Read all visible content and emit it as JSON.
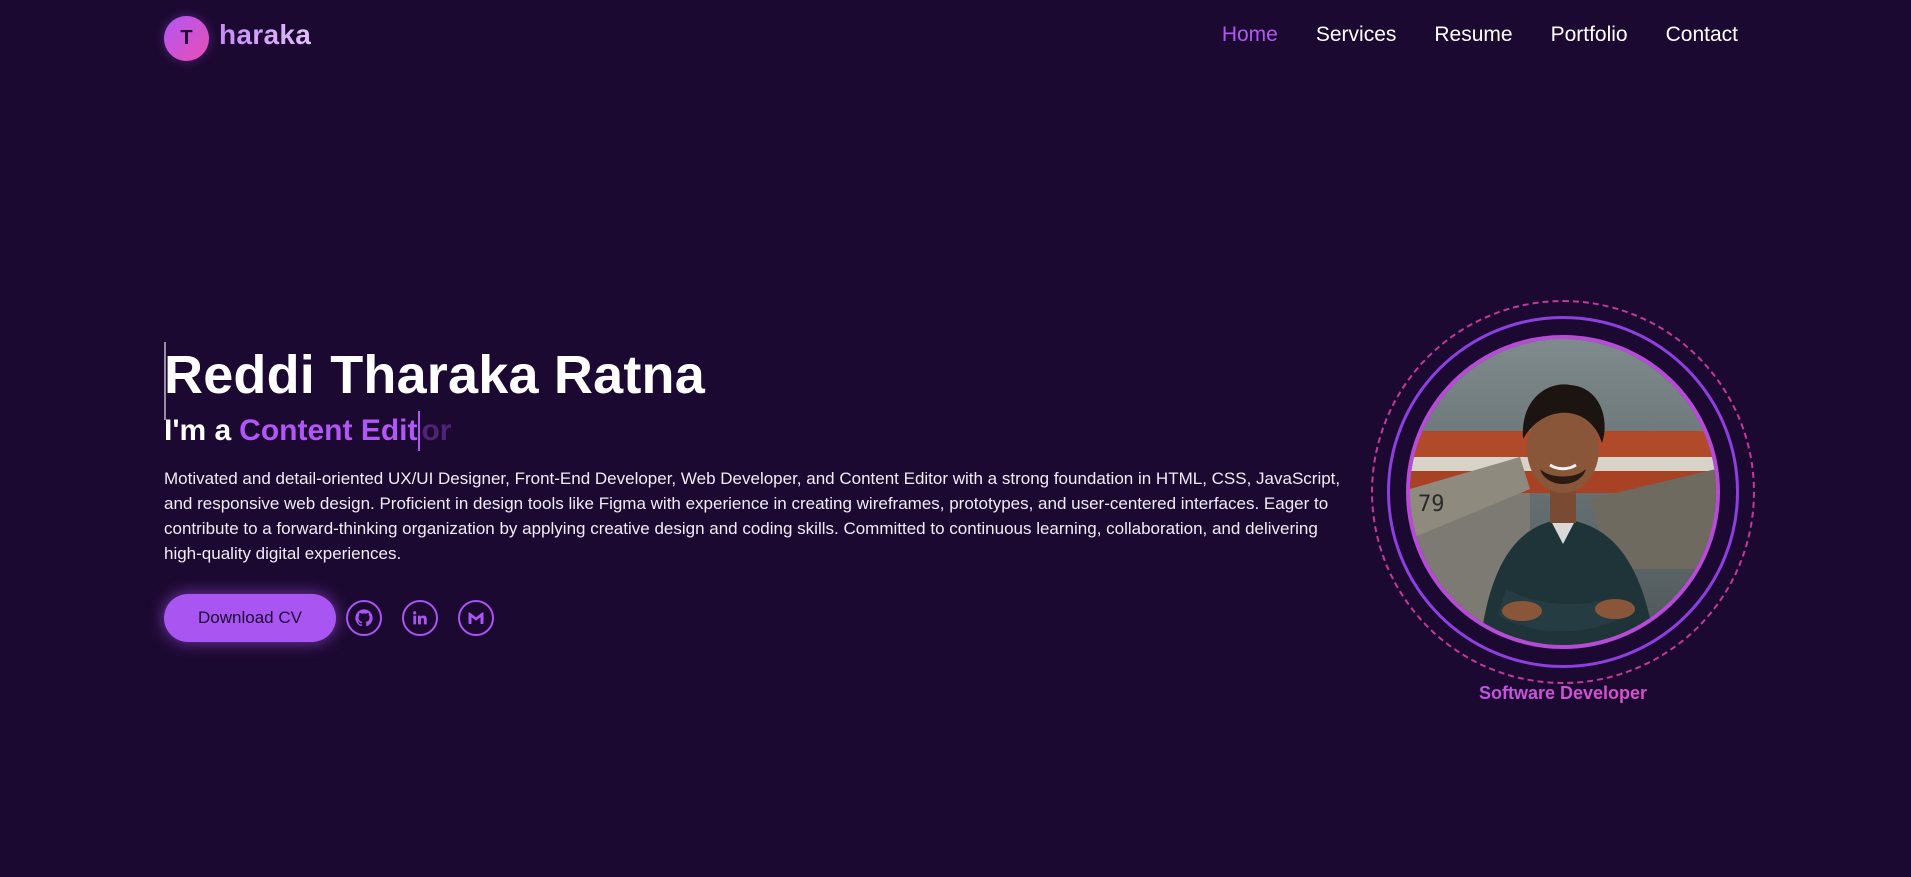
{
  "header": {
    "logo_letter": "T",
    "logo_text": "haraka",
    "nav": [
      {
        "label": "Home",
        "active": true
      },
      {
        "label": "Services",
        "active": false
      },
      {
        "label": "Resume",
        "active": false
      },
      {
        "label": "Portfolio",
        "active": false
      },
      {
        "label": "Contact",
        "active": false
      }
    ]
  },
  "hero": {
    "name": "Reddi Tharaka Ratna",
    "role_prefix": "I'm a",
    "role_typed": "Content Edit",
    "role_remaining": "or",
    "description": "Motivated and detail-oriented UX/UI Designer, Front-End Developer, Web Developer, and Content Editor with a strong foundation in HTML, CSS, JavaScript, and responsive web design. Proficient in design tools like Figma with experience in creating wireframes, prototypes, and user-centered interfaces. Eager to contribute to a forward-thinking organization by applying creative design and coding skills. Committed to continuous learning, collaboration, and delivering high-quality digital experiences.",
    "cv_button": "Download CV",
    "socials": [
      {
        "icon": "github-icon"
      },
      {
        "icon": "linkedin-icon"
      },
      {
        "icon": "gmail-icon"
      }
    ]
  },
  "portrait": {
    "caption": "Software Developer"
  },
  "colors": {
    "background": "#1c0931",
    "accent": "#b157f5",
    "accent_pink": "#e84fb4",
    "text": "#ffffff"
  }
}
